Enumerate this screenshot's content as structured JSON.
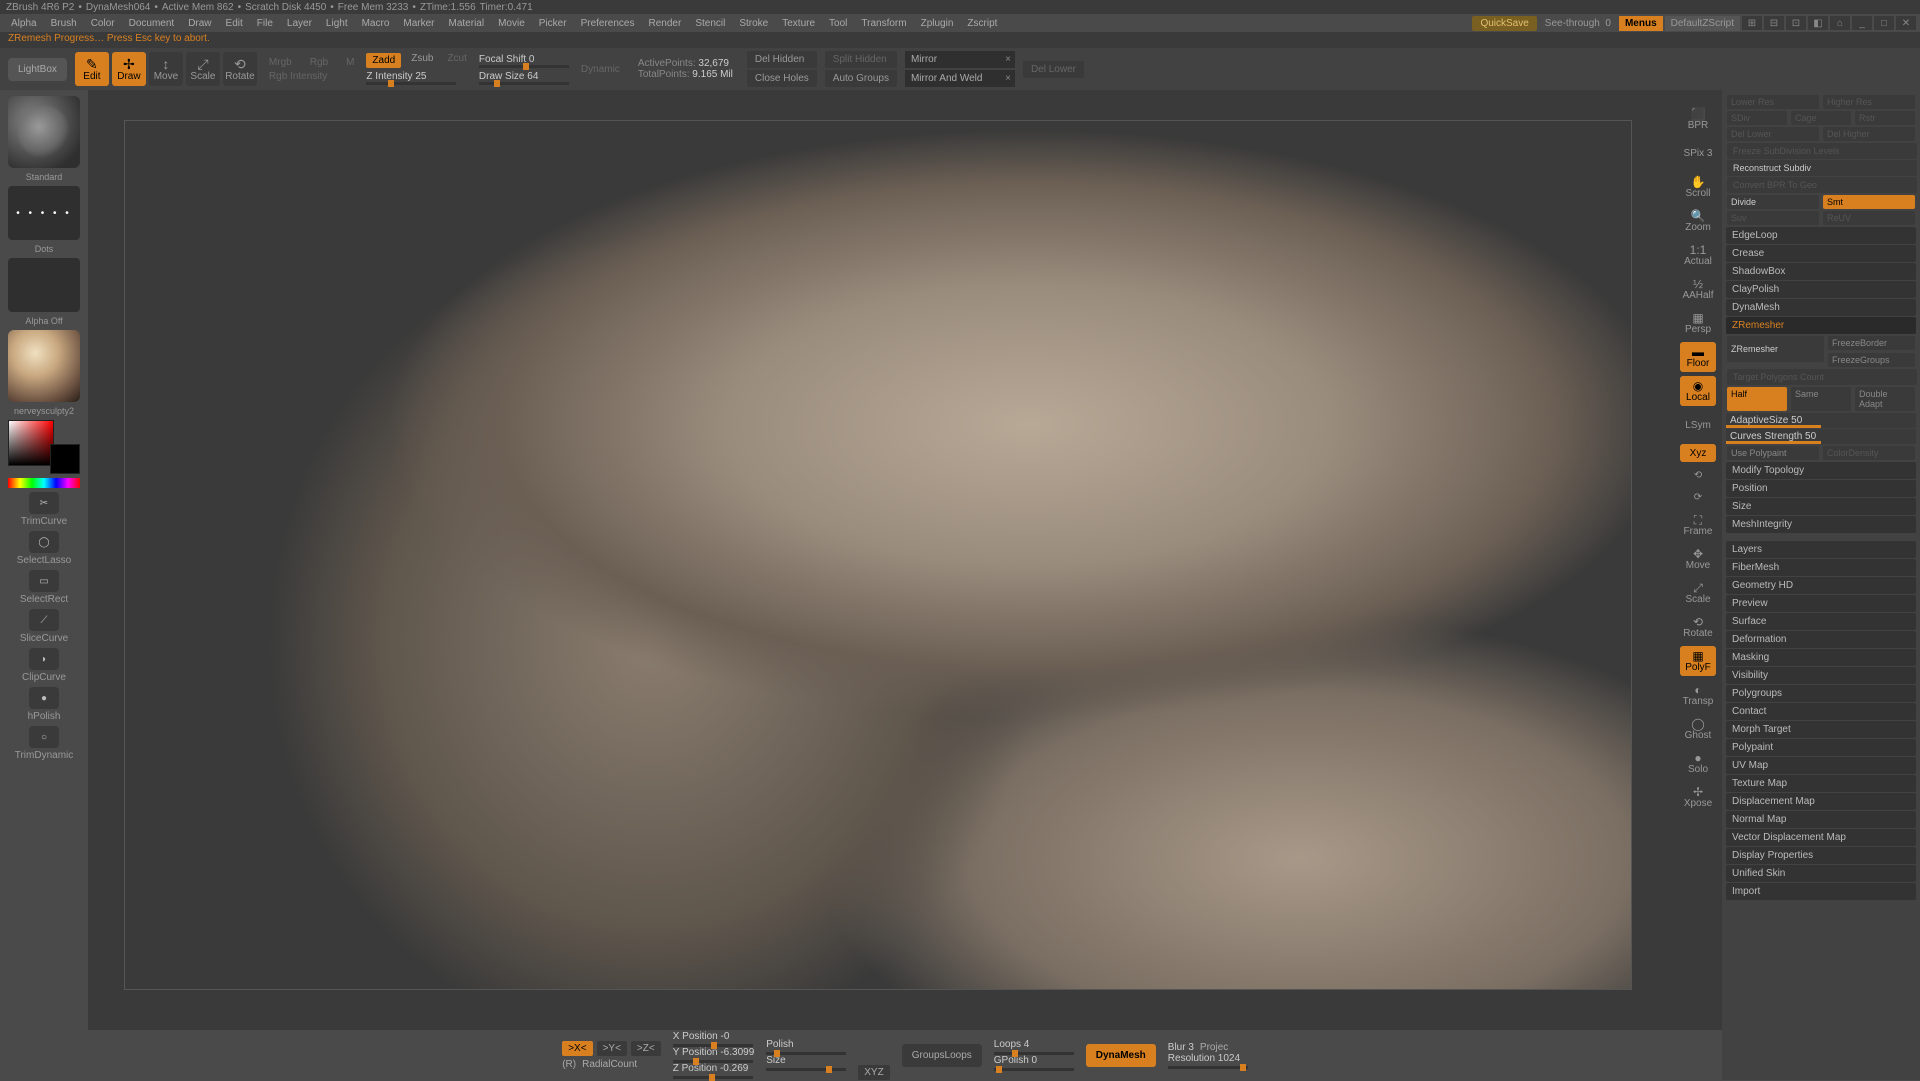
{
  "title": {
    "app": "ZBrush 4R6 P2",
    "doc": "DynaMesh064",
    "mem": "Active Mem 862",
    "scratch": "Scratch Disk 4450",
    "free": "Free Mem 3233",
    "ztime": "ZTime:1.556",
    "timer": "Timer:0.471"
  },
  "menu": [
    "Alpha",
    "Brush",
    "Color",
    "Document",
    "Draw",
    "Edit",
    "File",
    "Layer",
    "Light",
    "Macro",
    "Marker",
    "Material",
    "Movie",
    "Picker",
    "Preferences",
    "Render",
    "Stencil",
    "Stroke",
    "Texture",
    "Tool",
    "Transform",
    "Zplugin",
    "Zscript"
  ],
  "topbtns": {
    "quicksave": "QuickSave",
    "see": "See-through",
    "see_v": "0",
    "menus": "Menus",
    "defscript": "DefaultZScript"
  },
  "status": "ZRemesh Progress… Press Esc key to abort.",
  "shelf": {
    "lightbox": "LightBox",
    "edit": "Edit",
    "draw": "Draw",
    "move": "Move",
    "scale": "Scale",
    "rotate": "Rotate",
    "mrgb": "Mrgb",
    "rgb": "Rgb",
    "m": "M",
    "rgbint": "Rgb Intensity",
    "zadd": "Zadd",
    "zsub": "Zsub",
    "zcut": "Zcut",
    "zint": "Z Intensity 25",
    "focal": "Focal Shift 0",
    "drawsize": "Draw Size 64",
    "dynamic": "Dynamic",
    "active": "ActivePoints:",
    "active_v": "32,679",
    "total": "TotalPoints:",
    "total_v": "9.165 Mil",
    "delh": "Del Hidden",
    "splith": "Split Hidden",
    "closeh": "Close Holes",
    "autog": "Auto Groups",
    "dell": "Del Lower",
    "mirror": "Mirror",
    "maw": "Mirror And Weld"
  },
  "left": {
    "brush": "Standard",
    "stroke": "Dots",
    "alpha": "Alpha  Off",
    "mat": "nerveysculpty2",
    "tools": [
      "TrimCurve",
      "SelectLasso",
      "SelectRect",
      "SliceCurve",
      "ClipCurve",
      "hPolish",
      "TrimDynamic"
    ]
  },
  "nav": {
    "bpr": "BPR",
    "spix": "SPix 3",
    "scroll": "Scroll",
    "zoom": "Zoom",
    "actual": "Actual",
    "aahalf": "AAHalf",
    "persp": "Persp",
    "floor": "Floor",
    "local": "Local",
    "lsym": "LSym",
    "xyz": "Xyz",
    "frame": "Frame",
    "move": "Move",
    "scale": "Scale",
    "rotate": "Rotate",
    "polyf": "PolyF",
    "transp": "Transp",
    "ghost": "Ghost",
    "solo": "Solo",
    "xpose": "Xpose"
  },
  "right": {
    "row1": [
      "Lower Res",
      "Higher Res"
    ],
    "row2": [
      "SDiv",
      "Cage",
      "Rstr"
    ],
    "row3": [
      "Del Lower",
      "Del Higher"
    ],
    "freeze": "Freeze SubDivision Levels",
    "reconstruct": "Reconstruct Subdiv",
    "convert": "Convert BPR To Geo",
    "divide": "Divide",
    "smt": "Smt",
    "suv": "Suv",
    "reuv": "ReUV",
    "sections": [
      "EdgeLoop",
      "Crease",
      "ShadowBox",
      "ClayPolish",
      "DynaMesh"
    ],
    "zrem": "ZRemesher",
    "zrem_btn": "ZRemesher",
    "fb": "FreezeBorder",
    "fg": "FreezeGroups",
    "tpc": "Target Polygons Count",
    "half": "Half",
    "same": "Same",
    "da": "Double Adapt",
    "adapt": "AdaptiveSize 50",
    "curves": "Curves Strength 50",
    "usepp": "Use Polypaint",
    "cd": "ColorDensity",
    "mt": "Modify Topology",
    "pos": "Position",
    "size": "Size",
    "mi": "MeshIntegrity",
    "panels": [
      "Layers",
      "FiberMesh",
      "Geometry HD",
      "Preview",
      "Surface",
      "Deformation",
      "Masking",
      "Visibility",
      "Polygroups",
      "Contact",
      "Morph Target",
      "Polypaint",
      "UV Map",
      "Texture Map",
      "Displacement Map",
      "Normal Map",
      "Vector Displacement Map",
      "Display Properties",
      "Unified Skin",
      "Import"
    ]
  },
  "bottom": {
    "sx": ">X<",
    "sy": ">Y<",
    "sz": ">Z<",
    "r": "(R)",
    "radial": "RadialCount",
    "xpos": "X Position -0",
    "ypos": "Y Position -6.3099",
    "zpos": "Z Position -0.269",
    "polish": "Polish",
    "size": "Size",
    "xyz": "XYZ",
    "gl": "GroupsLoops",
    "loops": "Loops 4",
    "gp": "GPolish 0",
    "dynamesh": "DynaMesh",
    "blur": "Blur 3",
    "proj": "Projec",
    "res": "Resolution 1024"
  }
}
